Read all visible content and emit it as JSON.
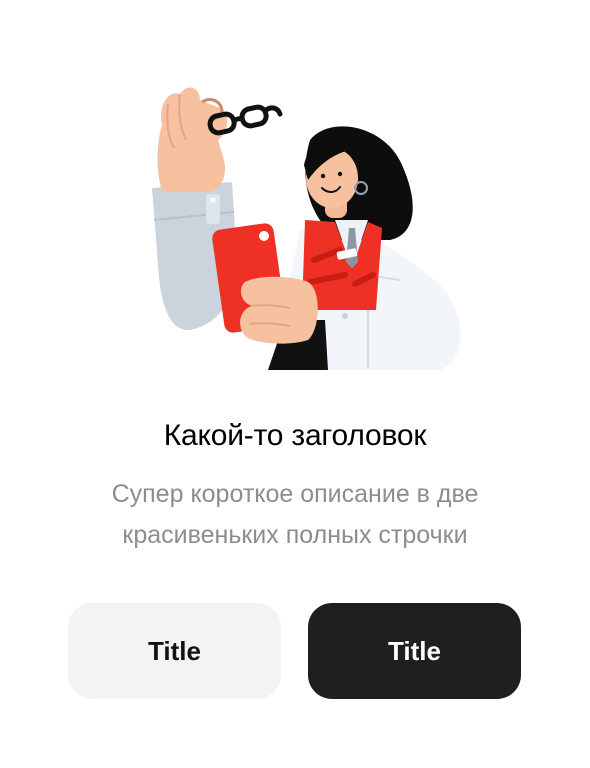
{
  "content": {
    "title": "Какой-то заголовок",
    "description_line1": "Супер короткое описание в две",
    "description_line2": "красивеньких полных строчки"
  },
  "buttons": {
    "secondary_label": "Title",
    "primary_label": "Title"
  },
  "illustration": {
    "subject": "woman-holding-phone-and-glasses",
    "accent_color": "#ee3124"
  },
  "colors": {
    "primary_button_bg": "#1f1f21",
    "secondary_button_bg": "#f2f3f5",
    "subtitle_text": "#8b8d92"
  }
}
